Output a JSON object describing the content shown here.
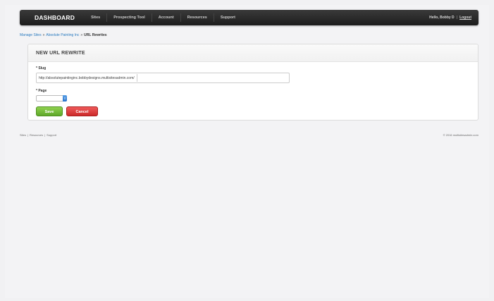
{
  "header": {
    "brand": "DASHBOARD",
    "nav": [
      "Sites",
      "Prospecting Tool",
      "Account",
      "Resources",
      "Support"
    ],
    "greeting": "Hello, Bobby D",
    "separator": "|",
    "logout": "Logout"
  },
  "breadcrumb": {
    "items": [
      "Manage Sites",
      "Absolute Painting Inc",
      "URL Rewrites"
    ],
    "separator": "»"
  },
  "panel": {
    "title": "NEW URL REWRITE",
    "slug_label": "* Slug",
    "slug_prefix": "http://absolutepaintinginc.bobbydesigns.multisitesadmin.com/",
    "slug_value": "",
    "page_label": "* Page",
    "page_value": "",
    "save_label": "Save",
    "cancel_label": "Cancel"
  },
  "footer": {
    "left_links": [
      "Sites",
      "Resources",
      "Support"
    ],
    "separator": "|",
    "copyright": "© 2016 multisitesadmin.com"
  },
  "colors": {
    "save": "#6bb534",
    "cancel": "#d93a3a",
    "link": "#2b7bbf",
    "topbar": "#262626"
  },
  "icons": [
    "select-arrow-icon"
  ]
}
